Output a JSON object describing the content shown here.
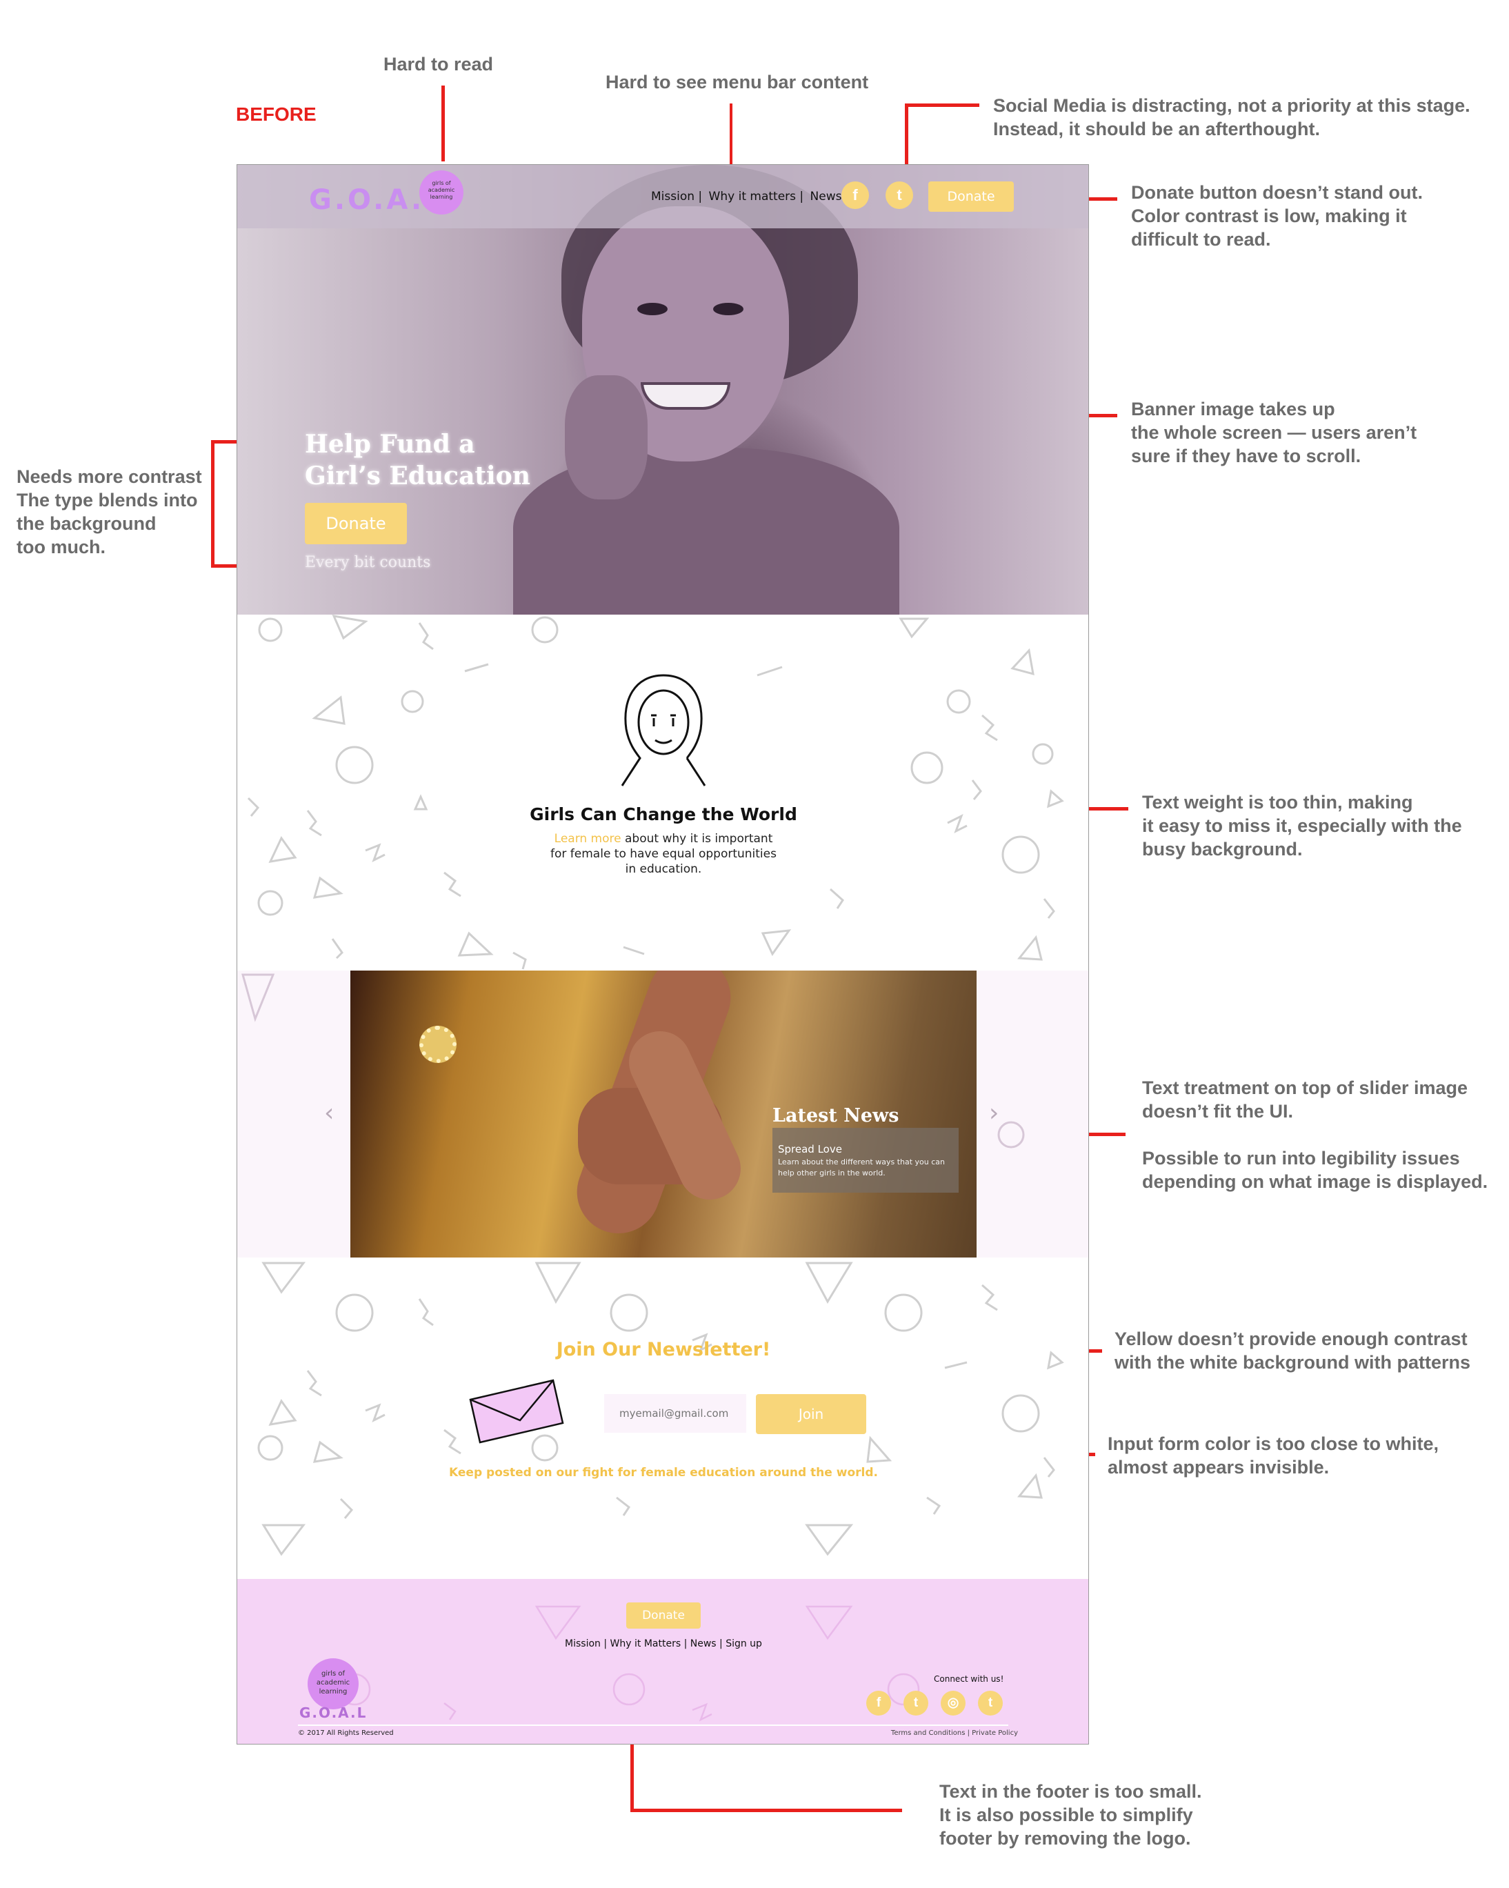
{
  "annotations": {
    "before_label": "BEFORE",
    "hard_to_read": "Hard to read",
    "menu_bar": "Hard to see menu bar content",
    "social_media": "Social Media is distracting, not a priority at this stage.\nInstead, it should be an afterthought.",
    "donate_button": "Donate button doesn’t stand out.\nColor contrast is low, making it\ndifficult to read.",
    "banner_image": "Banner image takes up\nthe whole screen — users aren’t\nsure if they have to scroll.",
    "needs_contrast": "Needs more contrast\nThe type blends into\nthe background\ntoo much.",
    "text_weight": "Text weight is too thin, making\nit easy to miss it, especially with the\nbusy background.",
    "slider_text": "Text treatment on top of slider image\ndoesn’t fit the UI.\n\nPossible to run into legibility issues\ndepending on what image is displayed.",
    "yellow_contrast": "Yellow doesn’t provide enough contrast\nwith the white background with patterns",
    "input_color": "Input form color is too close to white,\nalmost appears invisible.",
    "footer_text": "Text in the footer is too small.\nIt is also possible to simplify\nfooter by removing the logo."
  },
  "colors": {
    "annotation_red": "#e8201c",
    "annotation_gray": "#6b6b6b",
    "brand_yellow": "#f8d67a",
    "brand_purple": "#d88df0",
    "footer_pink": "#f5d4f6"
  },
  "header": {
    "logo_text": "G.O.A.L",
    "logo_badge": [
      "girls of",
      "academic",
      "learning"
    ],
    "nav_items": [
      "Mission |",
      "Why it matters |",
      "News"
    ],
    "social_icons": [
      {
        "name": "facebook-icon",
        "glyph": "f"
      },
      {
        "name": "twitter-icon",
        "glyph": "t"
      }
    ],
    "donate_label": "Donate"
  },
  "hero": {
    "title_line1": "Help Fund a",
    "title_line2": "Girl’s Education",
    "donate_label": "Donate",
    "tagline": "Every bit counts"
  },
  "mission": {
    "title": "Girls Can Change the World",
    "link_text": "Learn more",
    "body_line1": " about why it is important",
    "body_line2": "for female to have equal opportunities",
    "body_line3": "in education."
  },
  "slider": {
    "heading": "Latest News",
    "subheading": "Spread Love",
    "description": "Learn about the different ways that you can help other girls in the world.",
    "prev_glyph": "‹",
    "next_glyph": "›"
  },
  "newsletter": {
    "title": "Join Our Newsletter!",
    "input_placeholder": "myemail@gmail.com",
    "join_label": "Join",
    "tagline": "Keep posted on our fight for female education around the world."
  },
  "footer": {
    "donate_label": "Donate",
    "links": "Mission | Why it Matters | News | Sign up",
    "logo_badge": [
      "girls of",
      "academic",
      "learning"
    ],
    "logo_text": "G.O.A.L",
    "connect": "Connect with us!",
    "social_icons": [
      {
        "name": "facebook-icon",
        "glyph": "f"
      },
      {
        "name": "twitter-icon",
        "glyph": "t"
      },
      {
        "name": "instagram-icon",
        "glyph": "◎"
      },
      {
        "name": "tumblr-icon",
        "glyph": "t"
      }
    ],
    "copyright": "© 2017 All Rights Reserved",
    "legal": "Terms and Conditions | Private Policy"
  }
}
